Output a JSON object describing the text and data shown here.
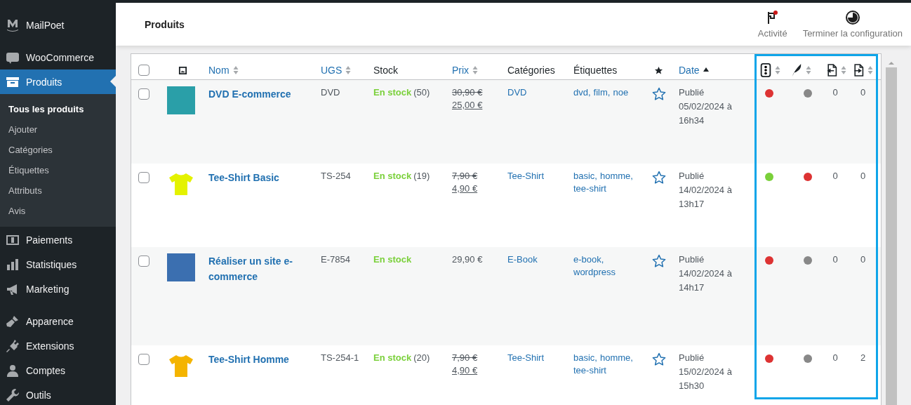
{
  "sidebar": {
    "items": [
      {
        "label": "MailPoet",
        "selected": false
      },
      {
        "label": "WooCommerce",
        "selected": false
      },
      {
        "label": "Produits",
        "selected": true,
        "children": [
          {
            "label": "Tous les produits",
            "selected": true
          },
          {
            "label": "Ajouter",
            "selected": false
          },
          {
            "label": "Catégories",
            "selected": false
          },
          {
            "label": "Étiquettes",
            "selected": false
          },
          {
            "label": "Attributs",
            "selected": false
          },
          {
            "label": "Avis",
            "selected": false
          }
        ]
      },
      {
        "label": "Paiements",
        "selected": false
      },
      {
        "label": "Statistiques",
        "selected": false
      },
      {
        "label": "Marketing",
        "selected": false
      },
      {
        "label": "Apparence",
        "selected": false
      },
      {
        "label": "Extensions",
        "selected": false
      },
      {
        "label": "Comptes",
        "selected": false
      },
      {
        "label": "Outils",
        "selected": false
      }
    ]
  },
  "header": {
    "title": "Produits",
    "actions": [
      {
        "kind": "activity",
        "label": "Activité",
        "notification": true
      },
      {
        "kind": "setup",
        "label": "Terminer la configuration"
      }
    ]
  },
  "table": {
    "columns": [
      {
        "kind": "checkbox",
        "checked": false
      },
      {
        "kind": "image"
      },
      {
        "kind": "sortable",
        "label": "Nom",
        "sorted": false
      },
      {
        "kind": "sortable",
        "label": "UGS",
        "sorted": false
      },
      {
        "kind": "text",
        "label": "Stock"
      },
      {
        "kind": "sortable",
        "label": "Prix",
        "sorted": false
      },
      {
        "kind": "text",
        "label": "Catégories"
      },
      {
        "kind": "text",
        "label": "Étiquettes"
      },
      {
        "kind": "star"
      },
      {
        "kind": "sortable",
        "label": "Date",
        "sorted": true
      },
      {
        "kind": "status",
        "sorted": false
      },
      {
        "kind": "feather",
        "sorted": false
      },
      {
        "kind": "link-in",
        "sorted": false
      },
      {
        "kind": "link-out",
        "sorted": false
      }
    ],
    "rows": [
      {
        "checked": false,
        "name": "DVD E-commerce",
        "sku": "DVD",
        "stock": "En stock",
        "stock_count": "(50)",
        "price": {
          "kind": "sale",
          "old": "30,90 €",
          "current": "25,00 €"
        },
        "categories": [
          "DVD"
        ],
        "tags": [
          "dvd,",
          "film,",
          "noe"
        ],
        "featured": false,
        "date_status": "Publié",
        "date": "05/02/2024 à 16h34",
        "status_dot": {
          "color": "#dd3333"
        },
        "seo_dot": {
          "color": "#888888"
        },
        "links_in": "0",
        "links_out": "0"
      },
      {
        "checked": false,
        "name": "Tee-Shirt Basic",
        "sku": "TS-254",
        "stock": "En stock",
        "stock_count": "(19)",
        "price": {
          "kind": "sale",
          "old": "7,90 €",
          "current": "4,90 €"
        },
        "categories": [
          "Tee-Shirt"
        ],
        "tags": [
          "basic,",
          "homme,",
          "tee-shirt"
        ],
        "featured": false,
        "date_status": "Publié",
        "date": "14/02/2024 à 13h17",
        "status_dot": {
          "color": "#7ad03a"
        },
        "seo_dot": {
          "color": "#dd3333"
        },
        "links_in": "0",
        "links_out": "0"
      },
      {
        "checked": false,
        "name": "Réaliser un site e-commerce",
        "sku": "E-7854",
        "stock": "En stock",
        "price": {
          "kind": "regular",
          "current": "29,90 €"
        },
        "categories": [
          "E-Book"
        ],
        "tags": [
          "e-book,",
          "wordpress"
        ],
        "featured": false,
        "date_status": "Publié",
        "date": "14/02/2024 à 14h17",
        "status_dot": {
          "color": "#dd3333"
        },
        "seo_dot": {
          "color": "#888888"
        },
        "links_in": "0",
        "links_out": "0"
      },
      {
        "checked": false,
        "name": "Tee-Shirt Homme",
        "sku": "TS-254-1",
        "stock": "En stock",
        "stock_count": "(20)",
        "price": {
          "kind": "sale",
          "old": "7,90 €",
          "current": "4,90 €"
        },
        "categories": [
          "Tee-Shirt"
        ],
        "tags": [
          "basic,",
          "homme,",
          "tee-shirt"
        ],
        "featured": false,
        "date_status": "Publié",
        "date": "15/02/2024 à 15h30",
        "status_dot": {
          "color": "#dd3333"
        },
        "seo_dot": {
          "color": "#888888"
        },
        "links_in": "0",
        "links_out": "2"
      }
    ]
  }
}
